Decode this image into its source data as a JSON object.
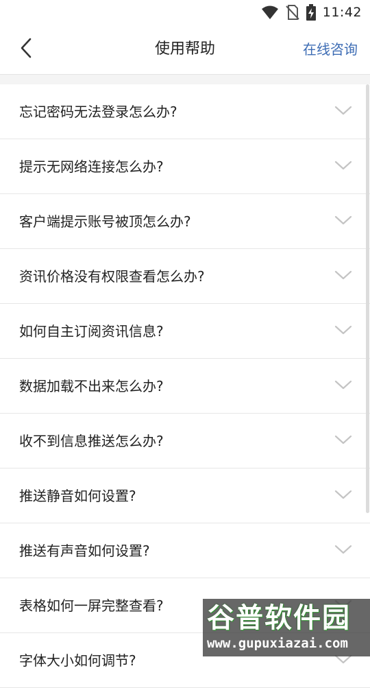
{
  "status_bar": {
    "time": "11:42",
    "icons": [
      "wifi-icon",
      "no-sim-icon",
      "battery-charging-icon"
    ]
  },
  "nav": {
    "back_icon": "chevron-left-icon",
    "title": "使用帮助",
    "consult_label": "在线咨询"
  },
  "colors": {
    "accent": "#3d6cb4",
    "divider": "#e6e6e6",
    "band": "#f4f4f4",
    "chevron": "#c4c4c4"
  },
  "faq": {
    "items": [
      {
        "question": "忘记密码无法登录怎么办?"
      },
      {
        "question": "提示无网络连接怎么办?"
      },
      {
        "question": "客户端提示账号被顶怎么办?"
      },
      {
        "question": "资讯价格没有权限查看怎么办?"
      },
      {
        "question": "如何自主订阅资讯信息?"
      },
      {
        "question": "数据加载不出来怎么办?"
      },
      {
        "question": "收不到信息推送怎么办?"
      },
      {
        "question": "推送静音如何设置?"
      },
      {
        "question": "推送有声音如何设置?"
      },
      {
        "question": "表格如何一屏完整查看?"
      },
      {
        "question": "字体大小如何调节?"
      }
    ],
    "expand_icon": "chevron-down-icon"
  },
  "watermark": {
    "title": "谷普软件园",
    "url": "www.gupuxiazai.com"
  }
}
